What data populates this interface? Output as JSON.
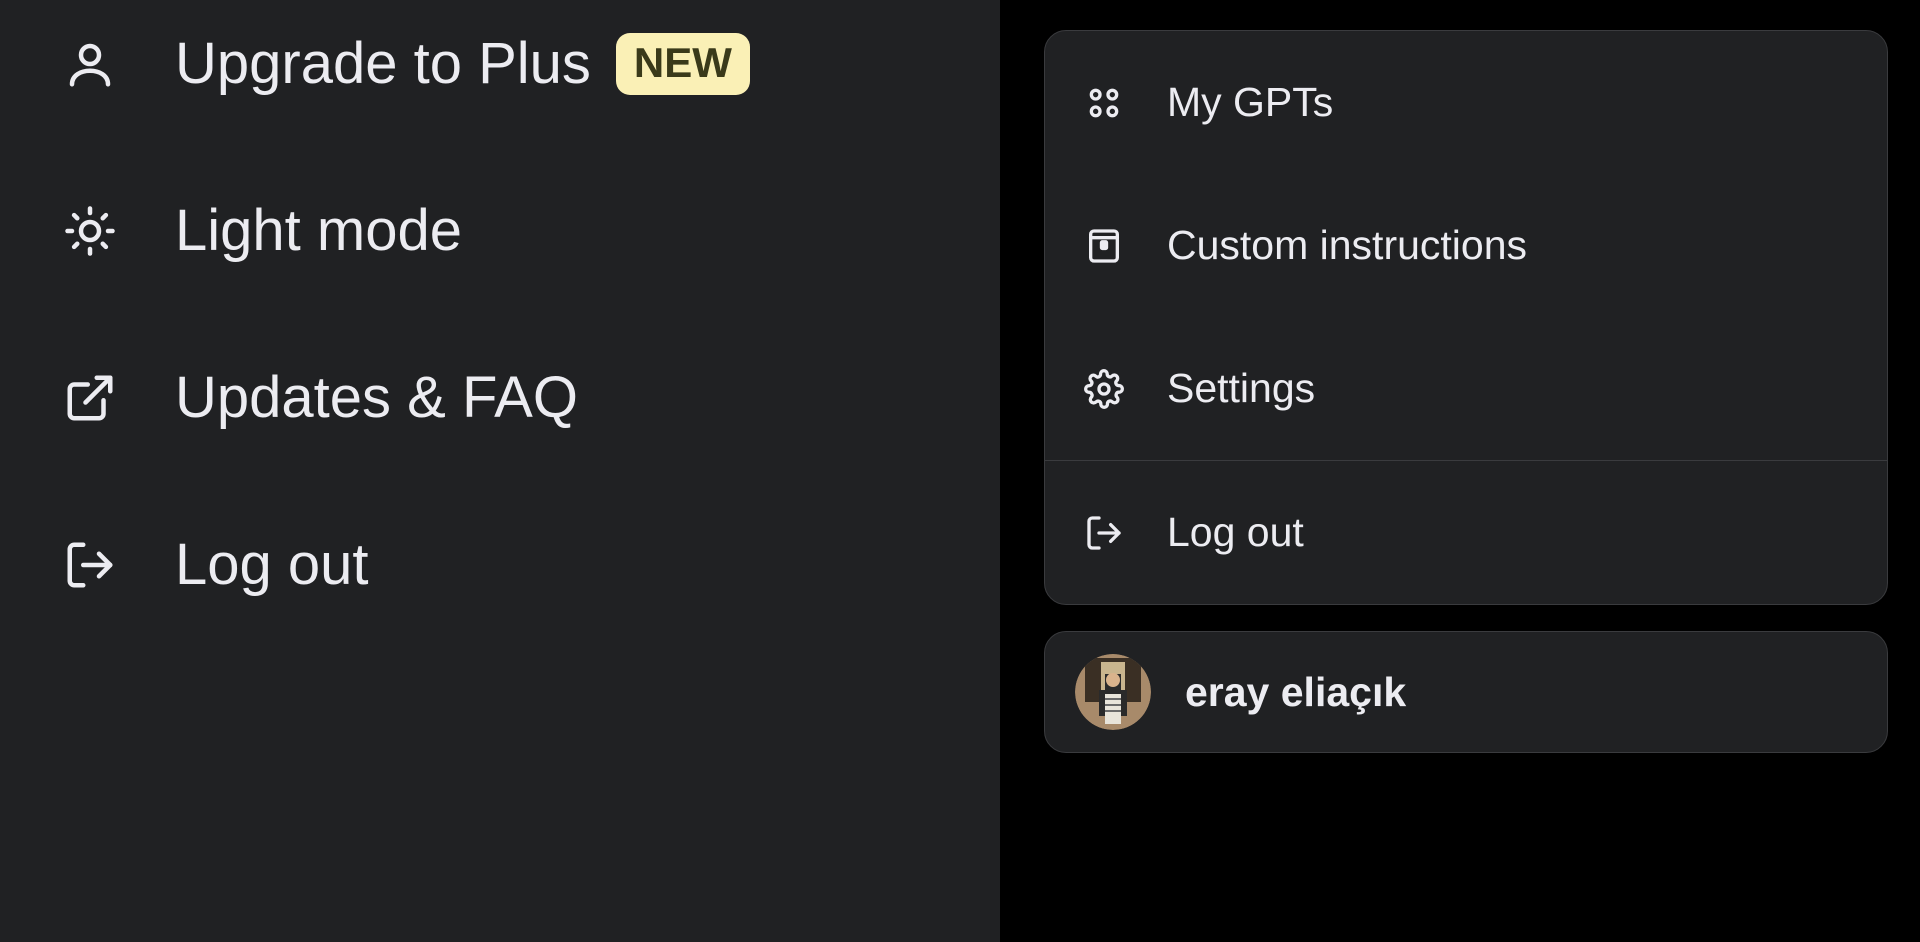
{
  "left_menu": {
    "upgrade": {
      "label": "Upgrade to Plus",
      "badge": "NEW"
    },
    "light_mode": {
      "label": "Light mode"
    },
    "updates_faq": {
      "label": "Updates & FAQ"
    },
    "logout": {
      "label": "Log out"
    }
  },
  "right_menu": {
    "my_gpts": {
      "label": "My GPTs"
    },
    "custom_instructions": {
      "label": "Custom instructions"
    },
    "settings": {
      "label": "Settings"
    },
    "logout": {
      "label": "Log out"
    }
  },
  "user": {
    "name": "eray eliaçık"
  },
  "colors": {
    "panel_bg": "#202123",
    "badge_bg": "#faf0b6",
    "text": "#ececf1"
  }
}
